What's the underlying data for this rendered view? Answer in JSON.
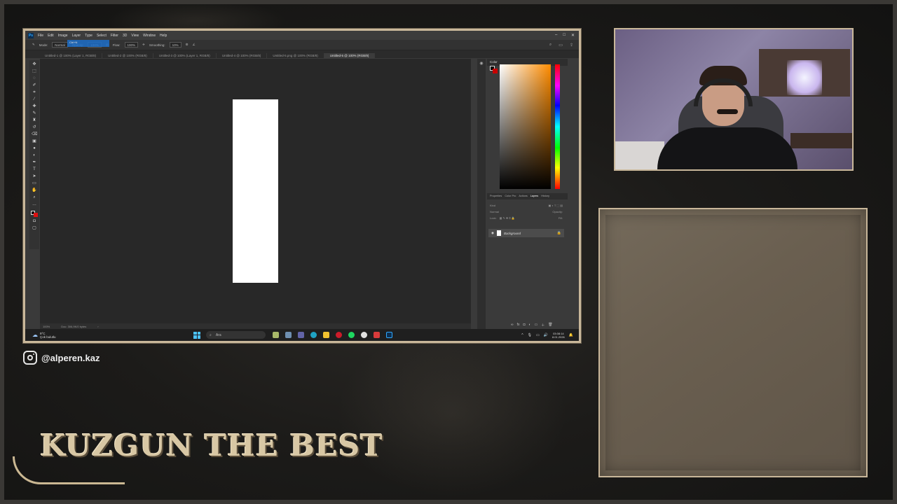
{
  "photoshop": {
    "menu": [
      "File",
      "Edit",
      "Image",
      "Layer",
      "Type",
      "Select",
      "Filter",
      "3D",
      "View",
      "Window",
      "Help"
    ],
    "logo": "Ps",
    "menu_hint": "Ctrl+N",
    "options": {
      "mode_label": "Mode:",
      "mode_value": "Normal",
      "opacity_label": "Opacity:",
      "opacity_value": "100%",
      "flow_label": "Flow:",
      "flow_value": "100%",
      "smoothing_label": "Smoothing:",
      "smoothing_value": "10%"
    },
    "doc_tabs": [
      "Untitled-1 @ 100% (Layer 1, RGB/8)",
      "Untitled-2 @ 100% (RGB/8)",
      "Untitled-3 @ 100% (Layer 1, RGB/8)",
      "Untitled-4 @ 100% (RGB/8)",
      "Untitled-5.png @ 100% (RGB/8)",
      "Untitled-5 @ 100% (RGB/8)"
    ],
    "status": {
      "zoom": "100%",
      "doc_info": "Doc: 306,9K/0 bytes"
    },
    "panels": {
      "color_title": "Color",
      "layer_tabs": [
        "Properties",
        "Color Pro",
        "Actions",
        "Layers",
        "History"
      ],
      "active_tab": "Layers",
      "search_placeholder": "Kind",
      "blend_mode": "Normal",
      "opacity_label": "Opacity:",
      "fill_label": "Fill:",
      "lock_label": "Lock:",
      "layer_name": "Background"
    }
  },
  "taskbar": {
    "weather_temp": "9°C",
    "weather_desc": "Çok bulutlu",
    "search_placeholder": "Ara",
    "time": "03:08:14",
    "date": "8.01.2026"
  },
  "social": {
    "handle": "@alperen.kaz"
  },
  "banner": {
    "text": "KUZGUN THE BEST"
  },
  "colors": {
    "frame_gold": "#c9b79a",
    "banner_text": "#d8c7a4",
    "ps_canvas": "#282828",
    "ps_accent": "#31a8ff"
  }
}
